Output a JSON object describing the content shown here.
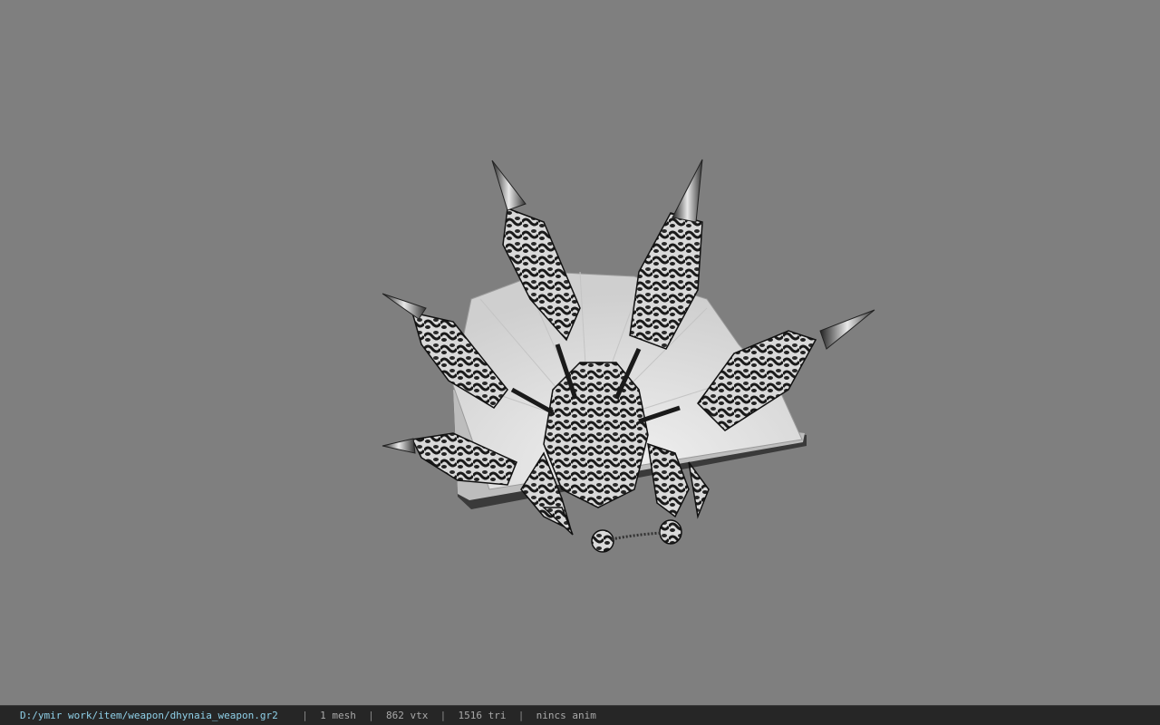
{
  "status_bar": {
    "file_path": "D:/ymir work/item/weapon/dhynaia_weapon.gr2",
    "mesh_count": "1 mesh",
    "vertex_count": "862 vtx",
    "triangle_count": "1516 tri",
    "anim_status": "nincs anim",
    "separator": "|"
  },
  "colors": {
    "background": "#7f7f7f",
    "status_bar": "#262626",
    "path_text": "#8fd0e8",
    "status_text": "#a9a9a9"
  }
}
